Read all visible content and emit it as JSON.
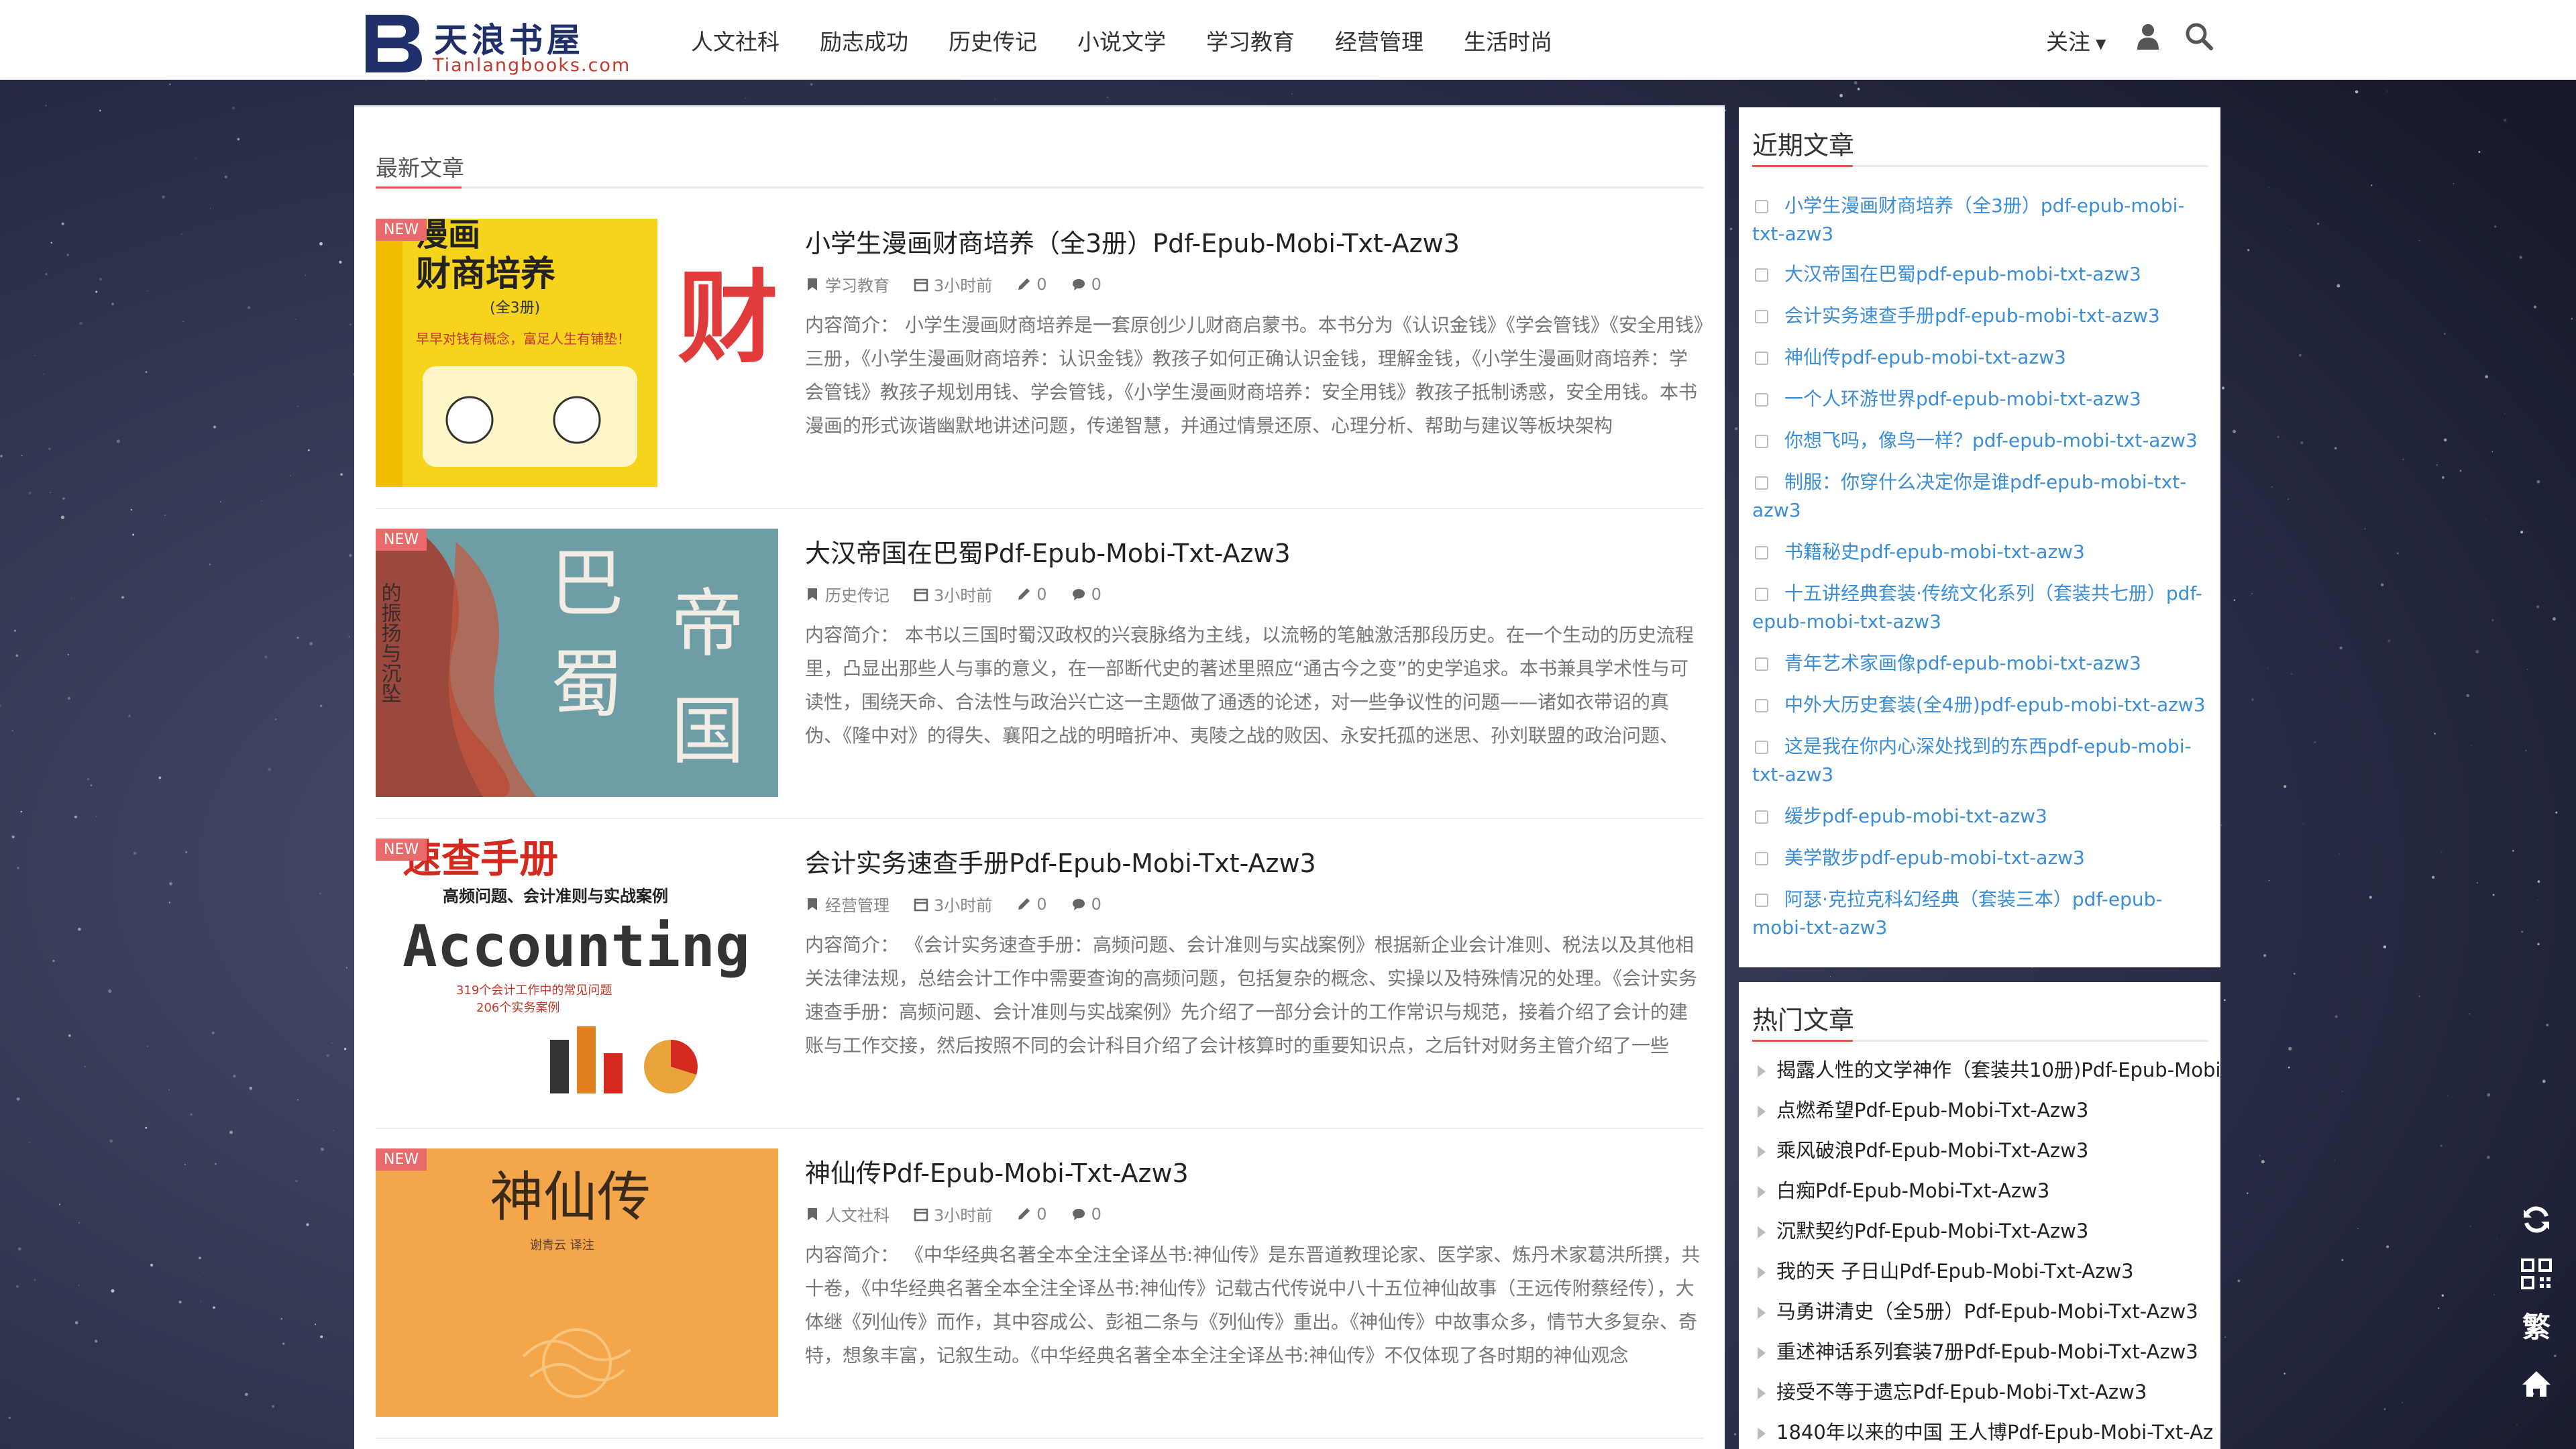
{
  "site": {
    "logo_cn": "天浪书屋",
    "logo_en": "Tianlangbooks.com",
    "nav": [
      "人文社科",
      "励志成功",
      "历史传记",
      "小说文学",
      "学习教育",
      "经营管理",
      "生活时尚"
    ],
    "follow_label": "关注"
  },
  "main": {
    "section_title": "最新文章",
    "badge": "NEW",
    "posts": [
      {
        "title": "小学生漫画财商培养（全3册）Pdf-Epub-Mobi-Txt-Azw3",
        "category": "学习教育",
        "time": "3小时前",
        "likes": "0",
        "comments": "0",
        "excerpt": "内容简介： 小学生漫画财商培养是一套原创少儿财商启蒙书。本书分为《认识金钱》《学会管钱》《安全用钱》三册，《小学生漫画财商培养：认识金钱》教孩子如何正确认识金钱，理解金钱，《小学生漫画财商培养：学会管钱》教孩子规划用钱、学会管钱，《小学生漫画财商培养：安全用钱》教孩子抵制诱惑，安全用钱。本书 漫画的形式诙谐幽默地讲述问题，传递智慧，并通过情景还原、心理分析、帮助与建议等板块架构",
        "thumb_text": [
          "漫画",
          "财商培养",
          "财",
          "(全3册)",
          "早早对钱有概念，富足人生有铺垫！"
        ]
      },
      {
        "title": "大汉帝国在巴蜀Pdf-Epub-Mobi-Txt-Azw3",
        "category": "历史传记",
        "time": "3小时前",
        "likes": "0",
        "comments": "0",
        "excerpt": "内容简介： 本书以三国时蜀汉政权的兴衰脉络为主线，以流畅的笔触激活那段历史。在一个生动的历史流程里，凸显出那些人与事的意义，在一部断代史的著述里照应“通古今之变”的史学追求。本书兼具学术性与可读性，围绕天命、合法性与政治兴亡这一主题做了通透的论述，对一些争议性的问题——诸如衣带诏的真伪、《隆中对》的得失、襄阳之战的明暗折冲、夷陵之战的败因、永安托孤的迷思、孙刘联盟的政治问题、",
        "thumb_text": [
          "巴",
          "蜀",
          "帝",
          "国",
          "的振扬与沉坠"
        ]
      },
      {
        "title": "会计实务速查手册Pdf-Epub-Mobi-Txt-Azw3",
        "category": "经营管理",
        "time": "3小时前",
        "likes": "0",
        "comments": "0",
        "excerpt": "内容简介： 《会计实务速查手册：高频问题、会计准则与实战案例》根据新企业会计准则、税法以及其他相关法律法规，总结会计工作中需要查询的高频问题，包括复杂的概念、实操以及特殊情况的处理。《会计实务速查手册：高频问题、会计准则与实战案例》先介绍了一部分会计的工作常识与规范，接着介绍了会计的建账与工作交接，然后按照不同的会计科目介绍了会计核算时的重要知识点，之后针对财务主管介绍了一些",
        "thumb_text": [
          "速查手册",
          "高频问题、会计准则与实战案例",
          "Accounting",
          "319个会计工作中的常见问题",
          "206个实务案例"
        ]
      },
      {
        "title": "神仙传Pdf-Epub-Mobi-Txt-Azw3",
        "category": "人文社科",
        "time": "3小时前",
        "likes": "0",
        "comments": "0",
        "excerpt": "内容简介： 《中华经典名著全本全注全译丛书:神仙传》是东晋道教理论家、医学家、炼丹术家葛洪所撰，共十卷，《中华经典名著全本全注全译丛书:神仙传》记载古代传说中八十五位神仙故事（王远传附蔡经传），大体继《列仙传》而作，其中容成公、彭祖二条与《列仙传》重出。《神仙传》中故事众多，情节大多复杂、奇特，想象丰富，记叙生动。《中华经典名著全本全注全译丛书:神仙传》不仅体现了各时期的神仙观念",
        "thumb_text": [
          "神仙传",
          "谢青云 译注"
        ]
      }
    ]
  },
  "sidebar": {
    "recent_title": "近期文章",
    "recent": [
      "小学生漫画财商培养（全3册）pdf-epub-mobi-txt-azw3",
      "大汉帝国在巴蜀pdf-epub-mobi-txt-azw3",
      "会计实务速查手册pdf-epub-mobi-txt-azw3",
      "神仙传pdf-epub-mobi-txt-azw3",
      "一个人环游世界pdf-epub-mobi-txt-azw3",
      "你想飞吗，像鸟一样？pdf-epub-mobi-txt-azw3",
      "制服：你穿什么决定你是谁pdf-epub-mobi-txt-azw3",
      "书籍秘史pdf-epub-mobi-txt-azw3",
      "十五讲经典套装·传统文化系列（套装共七册）pdf-epub-mobi-txt-azw3",
      "青年艺术家画像pdf-epub-mobi-txt-azw3",
      "中外大历史套装(全4册)pdf-epub-mobi-txt-azw3",
      "这是我在你内心深处找到的东西pdf-epub-mobi-txt-azw3",
      "缓步pdf-epub-mobi-txt-azw3",
      "美学散步pdf-epub-mobi-txt-azw3",
      "阿瑟·克拉克科幻经典（套装三本）pdf-epub-mobi-txt-azw3"
    ],
    "hot_title": "热门文章",
    "hot": [
      "揭露人性的文学神作（套装共10册)Pdf-Epub-Mobi",
      "点燃希望Pdf-Epub-Mobi-Txt-Azw3",
      "乘风破浪Pdf-Epub-Mobi-Txt-Azw3",
      "白痴Pdf-Epub-Mobi-Txt-Azw3",
      "沉默契约Pdf-Epub-Mobi-Txt-Azw3",
      "我的天 子日山Pdf-Epub-Mobi-Txt-Azw3",
      "马勇讲清史（全5册）Pdf-Epub-Mobi-Txt-Azw3",
      "重述神话系列套装7册Pdf-Epub-Mobi-Txt-Azw3",
      "接受不等于遗忘Pdf-Epub-Mobi-Txt-Azw3",
      "1840年以来的中国 王人博Pdf-Epub-Mobi-Txt-Az"
    ]
  },
  "tools": {
    "traditional_label": "繁"
  },
  "colors": {
    "accent_red": "#e05b4b",
    "link_blue": "#3a8dd6",
    "badge_red": "#e96a6a"
  }
}
